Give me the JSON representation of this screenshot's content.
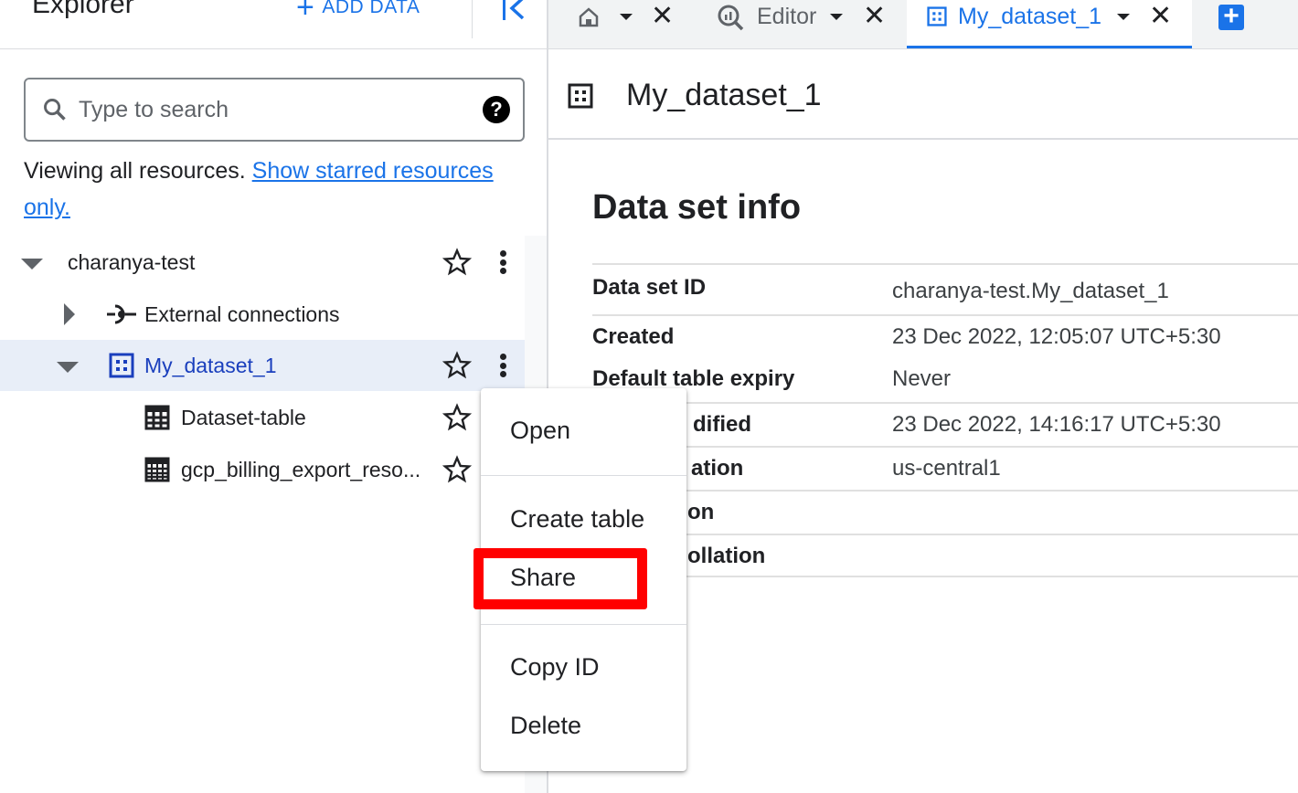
{
  "explorer": {
    "title": "Explorer",
    "add_data_label": "ADD DATA",
    "search_placeholder": "Type to search",
    "viewing_text": "Viewing all resources.",
    "starred_link": "Show starred resources only."
  },
  "tree": {
    "project": "charanya-test",
    "external_connections": "External connections",
    "dataset": "My_dataset_1",
    "tables": [
      "Dataset-table",
      "gcp_billing_export_reso..."
    ]
  },
  "tabs": [
    {
      "label": "",
      "icon": "home-icon"
    },
    {
      "label": "Editor",
      "icon": "query-icon"
    },
    {
      "label": "My_dataset_1",
      "icon": "dataset-icon",
      "active": true
    }
  ],
  "main": {
    "title": "My_dataset_1",
    "section_title": "Data set info",
    "rows": [
      {
        "key": "Data set ID",
        "value": "charanya-test.My_dataset_1"
      },
      {
        "key": "Created",
        "value": "23 Dec 2022, 12:05:07 UTC+5:30"
      },
      {
        "key": "Default table expiry",
        "value": "Never"
      },
      {
        "key": "dified",
        "value": "23 Dec 2022, 14:16:17 UTC+5:30"
      },
      {
        "key": "ation",
        "value": "us-central1"
      },
      {
        "key": "on",
        "value": ""
      },
      {
        "key": "ollation",
        "value": ""
      }
    ]
  },
  "context_menu": {
    "items": [
      "Open",
      "Create table",
      "Share",
      "Copy ID",
      "Delete"
    ],
    "highlighted": "Share"
  },
  "colors": {
    "accent": "#1a73e8",
    "selected_row": "#e8eef8",
    "highlight_box": "#ff0000"
  }
}
